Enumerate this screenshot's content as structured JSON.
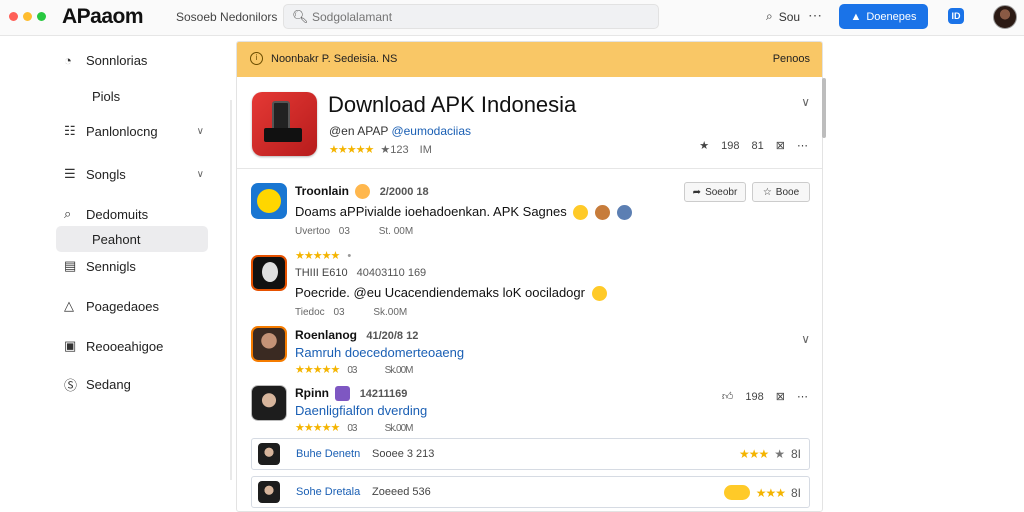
{
  "topbar": {
    "logo": "APaaom",
    "breadcrumb": "Sosoeb Nedonilors",
    "search_placeholder": "Sodgolalamant",
    "search_label": "Sou",
    "primary_button": "Doenepes",
    "ms_icon": "ID"
  },
  "sidebar": {
    "items": [
      {
        "label": "Sonnlorias",
        "icon": "clock-icon"
      },
      {
        "label": "Piols",
        "icon": ""
      },
      {
        "label": "Panlonlocng",
        "icon": "chart-icon"
      },
      {
        "label": "Songls",
        "icon": "list-icon"
      },
      {
        "label": "Dedomuits",
        "icon": "search-doc-icon"
      },
      {
        "label": "Peahont",
        "icon": ""
      },
      {
        "label": "Sennigls",
        "icon": "calendar-icon"
      },
      {
        "label": "Poagedaoes",
        "icon": "alert-icon"
      },
      {
        "label": "Reooeahigoe",
        "icon": "box-icon"
      },
      {
        "label": "Sedang",
        "icon": "settings-icon"
      }
    ]
  },
  "banner": {
    "text": "Noonbakr P. Sedeisia. NS",
    "right": "Penoos"
  },
  "app": {
    "title": "Download APK Indonesia",
    "handle": "@en APAP",
    "handle_link": "@eumodaciias",
    "rating_stars": "★★★★★",
    "rating_count": "★123",
    "rating_extra": "IM",
    "actions": {
      "likes": "198",
      "count": "81"
    }
  },
  "reviews": [
    {
      "name": "Troonlain",
      "date": "2/2000 18",
      "body": "Doams aPPivialde ioehadoenkan. APK Sagnes",
      "meta1": "Uvertoo",
      "meta2": "03",
      "meta3": "St. 00M",
      "btn1": "Soeobr",
      "btn2": "Booe"
    },
    {
      "stars": "★★★★★",
      "starsx": "•",
      "name": "THIII E610",
      "date": "40403110 169",
      "body": "Poecride. @eu Ucacendiendemaks loK oociladogr",
      "meta1": "Tiedoc",
      "meta2": "03",
      "meta3": "Sk.00M"
    },
    {
      "name": "Roenlanog",
      "date": "41/20/8 12",
      "body": "Ramruh doecedomerteoaeng",
      "stars": "★★★★★",
      "meta2": "03",
      "meta3": "Sk.00M"
    },
    {
      "name": "Rpinn",
      "date": "14211169",
      "body": "Daenligfialfon dverding",
      "stars": "★★★★★",
      "meta2": "03",
      "meta3": "Sk.00M",
      "likes": "198"
    }
  ],
  "mini_rows": [
    {
      "name": "Buhe Denetn",
      "date": "Sooee 3 213",
      "stars": "★★★",
      "extra": "8I"
    },
    {
      "name": "Sohe Dretala",
      "date": "Zoeeed 536",
      "stars": "★★★",
      "extra": "8I"
    }
  ],
  "colors": {
    "accent": "#1a73e8",
    "banner": "#f9c766",
    "star": "#f4b400",
    "link": "#1a5fb4"
  }
}
